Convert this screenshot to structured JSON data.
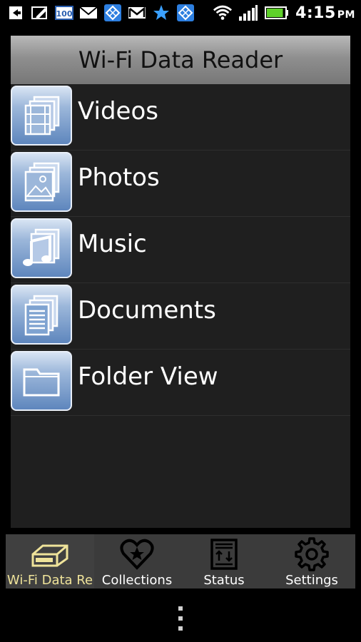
{
  "status_bar": {
    "time": "4:15",
    "ampm": "PM",
    "battery_level": 0.9,
    "icons": [
      "back-arrow-icon",
      "edit-icon",
      "100-badge-icon",
      "mail-icon",
      "app-icon",
      "gmail-icon",
      "star-icon",
      "app-icon",
      "wifi-icon",
      "signal-icon",
      "battery-icon"
    ]
  },
  "header": {
    "title": "Wi-Fi Data Reader"
  },
  "list": {
    "items": [
      {
        "label": "Videos",
        "icon": "videos-icon"
      },
      {
        "label": "Photos",
        "icon": "photos-icon"
      },
      {
        "label": "Music",
        "icon": "music-icon"
      },
      {
        "label": "Documents",
        "icon": "documents-icon"
      },
      {
        "label": "Folder View",
        "icon": "folder-icon"
      }
    ]
  },
  "tabs": [
    {
      "label": "Wi-Fi Data Re",
      "icon": "drive-icon",
      "active": true
    },
    {
      "label": "Collections",
      "icon": "heart-star-icon",
      "active": false
    },
    {
      "label": "Status",
      "icon": "status-icon",
      "active": false
    },
    {
      "label": "Settings",
      "icon": "gear-icon",
      "active": false
    }
  ],
  "colors": {
    "accent_tab": "#efe39a",
    "tile_blue": "#5e86bd",
    "battery_green": "#5fd12a"
  }
}
